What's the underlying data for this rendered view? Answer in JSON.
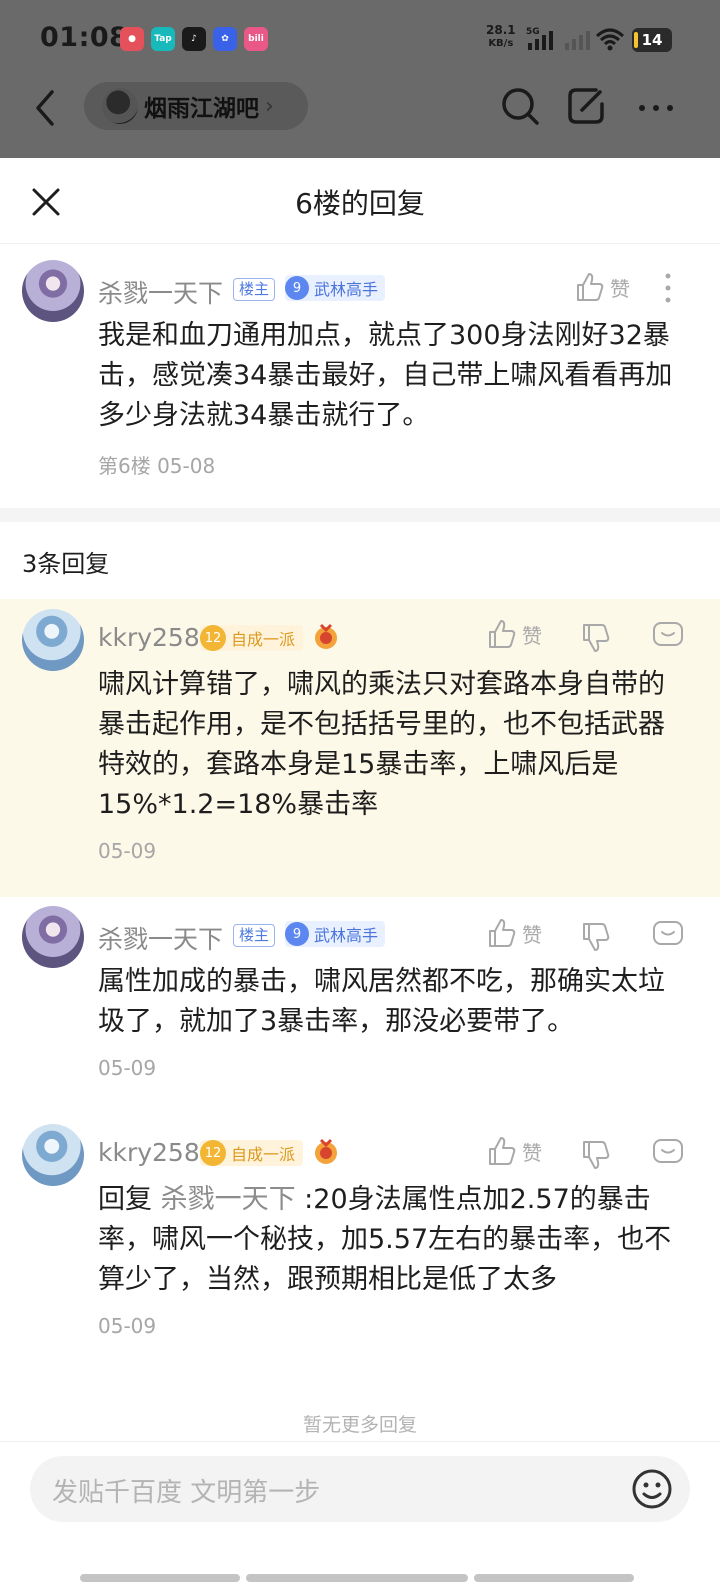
{
  "status_bar": {
    "time": "01:08",
    "net_speed_value": "28.1",
    "net_speed_unit": "KB/s",
    "network": "5G",
    "battery": "14",
    "app_icons": [
      {
        "name": "app-icon-1",
        "label": "",
        "color": "#f04d5a"
      },
      {
        "name": "taptap-icon",
        "label": "Tap",
        "color": "#18c5c7"
      },
      {
        "name": "music-app-icon",
        "label": "",
        "color": "#1a1a1a"
      },
      {
        "name": "baidu-app-icon",
        "label": "",
        "color": "#3a62e8"
      },
      {
        "name": "bilibili-icon",
        "label": "bili",
        "color": "#f05a8b"
      }
    ]
  },
  "header": {
    "forum_name": "烟雨江湖吧"
  },
  "sheet": {
    "title": "6楼的回复",
    "reply_count_label": "3条回复",
    "no_more_label": "暂无更多回复",
    "input_placeholder": "发贴千百度 文明第一步"
  },
  "labels": {
    "like": "赞",
    "louzhu": "楼主"
  },
  "main_post": {
    "username": "杀戮一天下",
    "is_louzhu": true,
    "level": "9",
    "title": "武林高手",
    "text": "我是和血刀通用加点，就点了300身法刚好32暴击，感觉凑34暴击最好，自己带上啸风看看再加多少身法就34暴击就行了。",
    "meta": "第6楼 05-08"
  },
  "replies": [
    {
      "username": "kkry258",
      "level": "12",
      "title": "自成一派",
      "text": "啸风计算错了，啸风的乘法只对套路本身自带的暴击起作用，是不包括括号里的，也不包括武器特效的，套路本身是15暴击率，上啸风后是15%*1.2=18%暴击率",
      "date": "05-09",
      "highlighted": true
    },
    {
      "username": "杀戮一天下",
      "is_louzhu": true,
      "level": "9",
      "title": "武林高手",
      "text": "属性加成的暴击，啸风居然都不吃，那确实太垃圾了，就加了3暴击率，那没必要带了。",
      "date": "05-09"
    },
    {
      "username": "kkry258",
      "level": "12",
      "title": "自成一派",
      "reply_prefix": "回复",
      "reply_to": "杀戮一天下",
      "text": " :20身法属性点加2.57的暴击率，啸风一个秘技，加5.57左右的暴击率，也不算少了，当然，跟预期相比是低了太多",
      "date": "05-09"
    }
  ],
  "colors": {
    "highlight_bg": "#fdf9e8",
    "level_blue": "#4a74dc",
    "level_gold": "#dc9a20"
  }
}
